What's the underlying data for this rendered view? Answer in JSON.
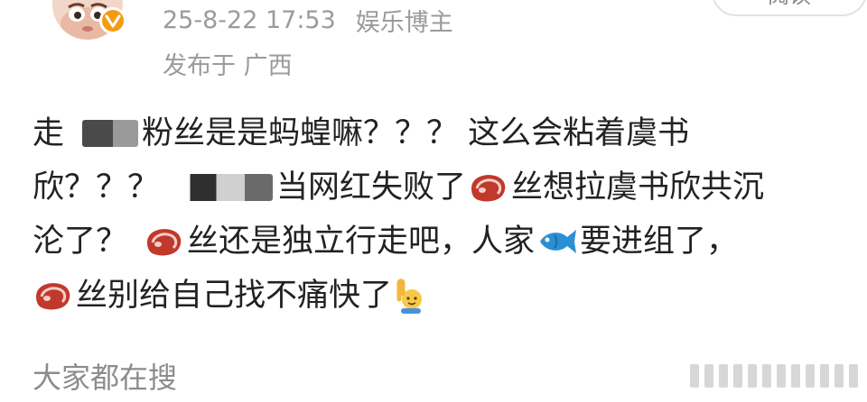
{
  "header": {
    "post_time": "25-8-22 17:53",
    "author_tag": "娱乐博主",
    "location": "发布于 广西",
    "follow_label": "阅读"
  },
  "post": {
    "line1": {
      "a": "走",
      "b": "粉丝是是蚂蝗嘛？？？ 这么会粘着虞书"
    },
    "line2": {
      "a": "欣？？？",
      "b": "当网红失败了",
      "c": "丝想拉虞书欣共沉"
    },
    "line3": {
      "a": "沦了？",
      "b": "丝还是独立行走吧，人家",
      "c": "要进组了，"
    },
    "line4": {
      "a": "丝别给自己找不痛快了"
    }
  },
  "footer": {
    "trending_label": "大家都在搜"
  },
  "icons": {
    "verified": "verified-badge-icon",
    "meat": "meat-emoji-icon",
    "fish": "fish-emoji-icon",
    "raised_hand": "raising-hand-emoji-icon"
  },
  "colors": {
    "text": "#222222",
    "meta": "#9b9b9b",
    "verified": "#f39c12",
    "meat": "#c0392b",
    "fish": "#2b8fd6"
  }
}
